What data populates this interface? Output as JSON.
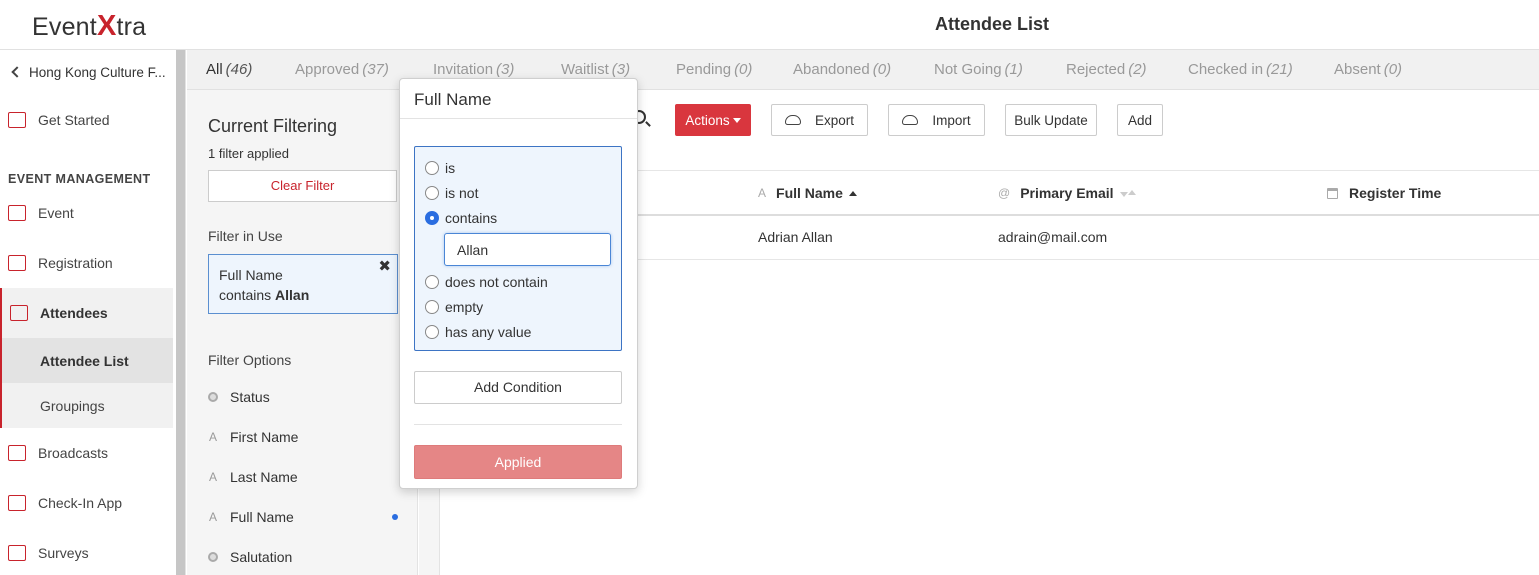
{
  "app": {
    "logo": {
      "left": "Event",
      "x": "X",
      "right": "tra"
    },
    "page_title": "Attendee List"
  },
  "sidebar": {
    "back_label": "Hong Kong Culture F...",
    "get_started": "Get Started",
    "section_heading": "EVENT MANAGEMENT",
    "items": [
      {
        "label": "Event",
        "icon": "calendar-icon"
      },
      {
        "label": "Registration",
        "icon": "form-icon"
      },
      {
        "label": "Attendees",
        "icon": "people-icon"
      },
      {
        "label": "Broadcasts",
        "icon": "envelope-icon"
      },
      {
        "label": "Check-In App",
        "icon": "scanner-icon"
      },
      {
        "label": "Surveys",
        "icon": "survey-icon"
      }
    ],
    "sub_items": [
      {
        "label": "Attendee List"
      },
      {
        "label": "Groupings"
      }
    ]
  },
  "tabs": [
    {
      "label": "All",
      "count": "(46)"
    },
    {
      "label": "Approved",
      "count": "(37)"
    },
    {
      "label": "Invitation",
      "count": "(3)"
    },
    {
      "label": "Waitlist",
      "count": "(3)"
    },
    {
      "label": "Pending",
      "count": "(0)"
    },
    {
      "label": "Abandoned",
      "count": "(0)"
    },
    {
      "label": "Not Going",
      "count": "(1)"
    },
    {
      "label": "Rejected",
      "count": "(2)"
    },
    {
      "label": "Checked in",
      "count": "(21)"
    },
    {
      "label": "Absent",
      "count": "(0)"
    }
  ],
  "filter_panel": {
    "title": "Current Filtering",
    "applied_text": "1 filter applied",
    "clear_label": "Clear Filter",
    "in_use_label": "Filter in Use",
    "active_filter": {
      "field": "Full Name",
      "operator": "contains",
      "value": "Allan",
      "remove": "✖"
    },
    "options_label": "Filter Options",
    "options": [
      {
        "label": "Status",
        "icon": "status-icon",
        "glyph": ""
      },
      {
        "label": "First Name",
        "icon": "text-icon",
        "glyph": "A"
      },
      {
        "label": "Last Name",
        "icon": "text-icon",
        "glyph": "A"
      },
      {
        "label": "Full Name",
        "icon": "text-icon",
        "glyph": "A"
      },
      {
        "label": "Salutation",
        "icon": "status-icon",
        "glyph": ""
      }
    ]
  },
  "toolbar": {
    "actions_label": "Actions",
    "export_label": "Export",
    "import_label": "Import",
    "bulk_update_label": "Bulk Update",
    "add_label": "Add"
  },
  "table": {
    "columns": [
      {
        "label": "Full Name",
        "icon": "A"
      },
      {
        "label": "Primary Email",
        "icon": "@"
      },
      {
        "label": "Register Time",
        "icon": ""
      }
    ],
    "rows": [
      {
        "full_name": "Adrian  Allan",
        "email": "adrain@mail.com",
        "register_time": ""
      }
    ]
  },
  "popup": {
    "title": "Full Name",
    "options": [
      "is",
      "is not",
      "contains",
      "does not contain",
      "empty",
      "has any value"
    ],
    "selected": "contains",
    "input_value": "Allan",
    "add_condition_label": "Add Condition",
    "applied_label": "Applied"
  }
}
